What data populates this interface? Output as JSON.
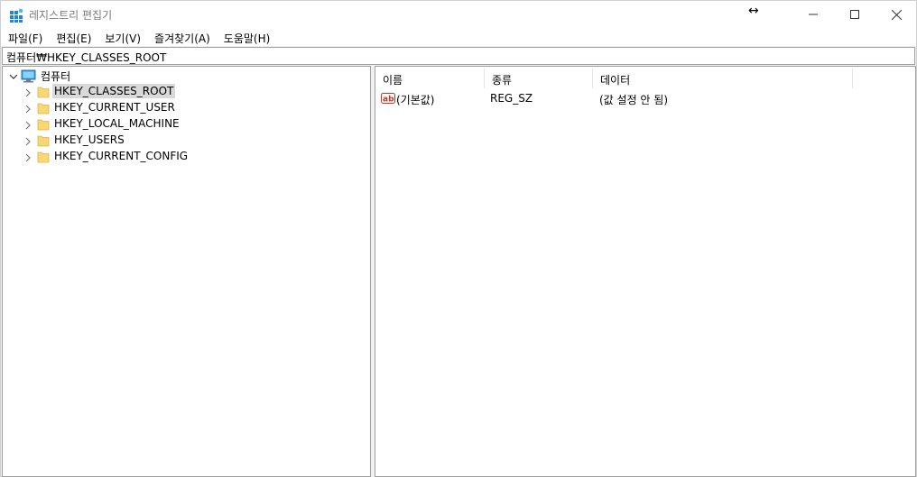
{
  "window": {
    "title": "레지스트리 편집기",
    "icons": {
      "app": "registry-editor-icon",
      "resize_cursor": "horizontal-resize-cursor-icon",
      "minimize": "minimize-icon",
      "maximize": "maximize-icon",
      "close": "close-icon"
    }
  },
  "menu": [
    {
      "label": "파일(F)"
    },
    {
      "label": "편집(E)"
    },
    {
      "label": "보기(V)"
    },
    {
      "label": "즐겨찾기(A)"
    },
    {
      "label": "도움말(H)"
    }
  ],
  "address": {
    "path": "컴퓨터₩HKEY_CLASSES_ROOT"
  },
  "tree": {
    "root": {
      "label": "컴퓨터",
      "icon": "computer-icon",
      "expanded": true
    },
    "children": [
      {
        "label": "HKEY_CLASSES_ROOT",
        "icon": "folder-icon",
        "selected": true
      },
      {
        "label": "HKEY_CURRENT_USER",
        "icon": "folder-icon",
        "selected": false
      },
      {
        "label": "HKEY_LOCAL_MACHINE",
        "icon": "folder-icon",
        "selected": false
      },
      {
        "label": "HKEY_USERS",
        "icon": "folder-icon",
        "selected": false
      },
      {
        "label": "HKEY_CURRENT_CONFIG",
        "icon": "folder-icon",
        "selected": false
      }
    ]
  },
  "list": {
    "columns": [
      "이름",
      "종류",
      "데이터"
    ],
    "rows": [
      {
        "name": "(기본값)",
        "type": "REG_SZ",
        "data": "(값 설정 안 됨)",
        "icon": "string-value-icon"
      }
    ]
  },
  "colors": {
    "selection": "#d9d9d9",
    "folder": "#f8d775",
    "border": "#a0a0a0",
    "title_text": "#7a7a7a"
  }
}
